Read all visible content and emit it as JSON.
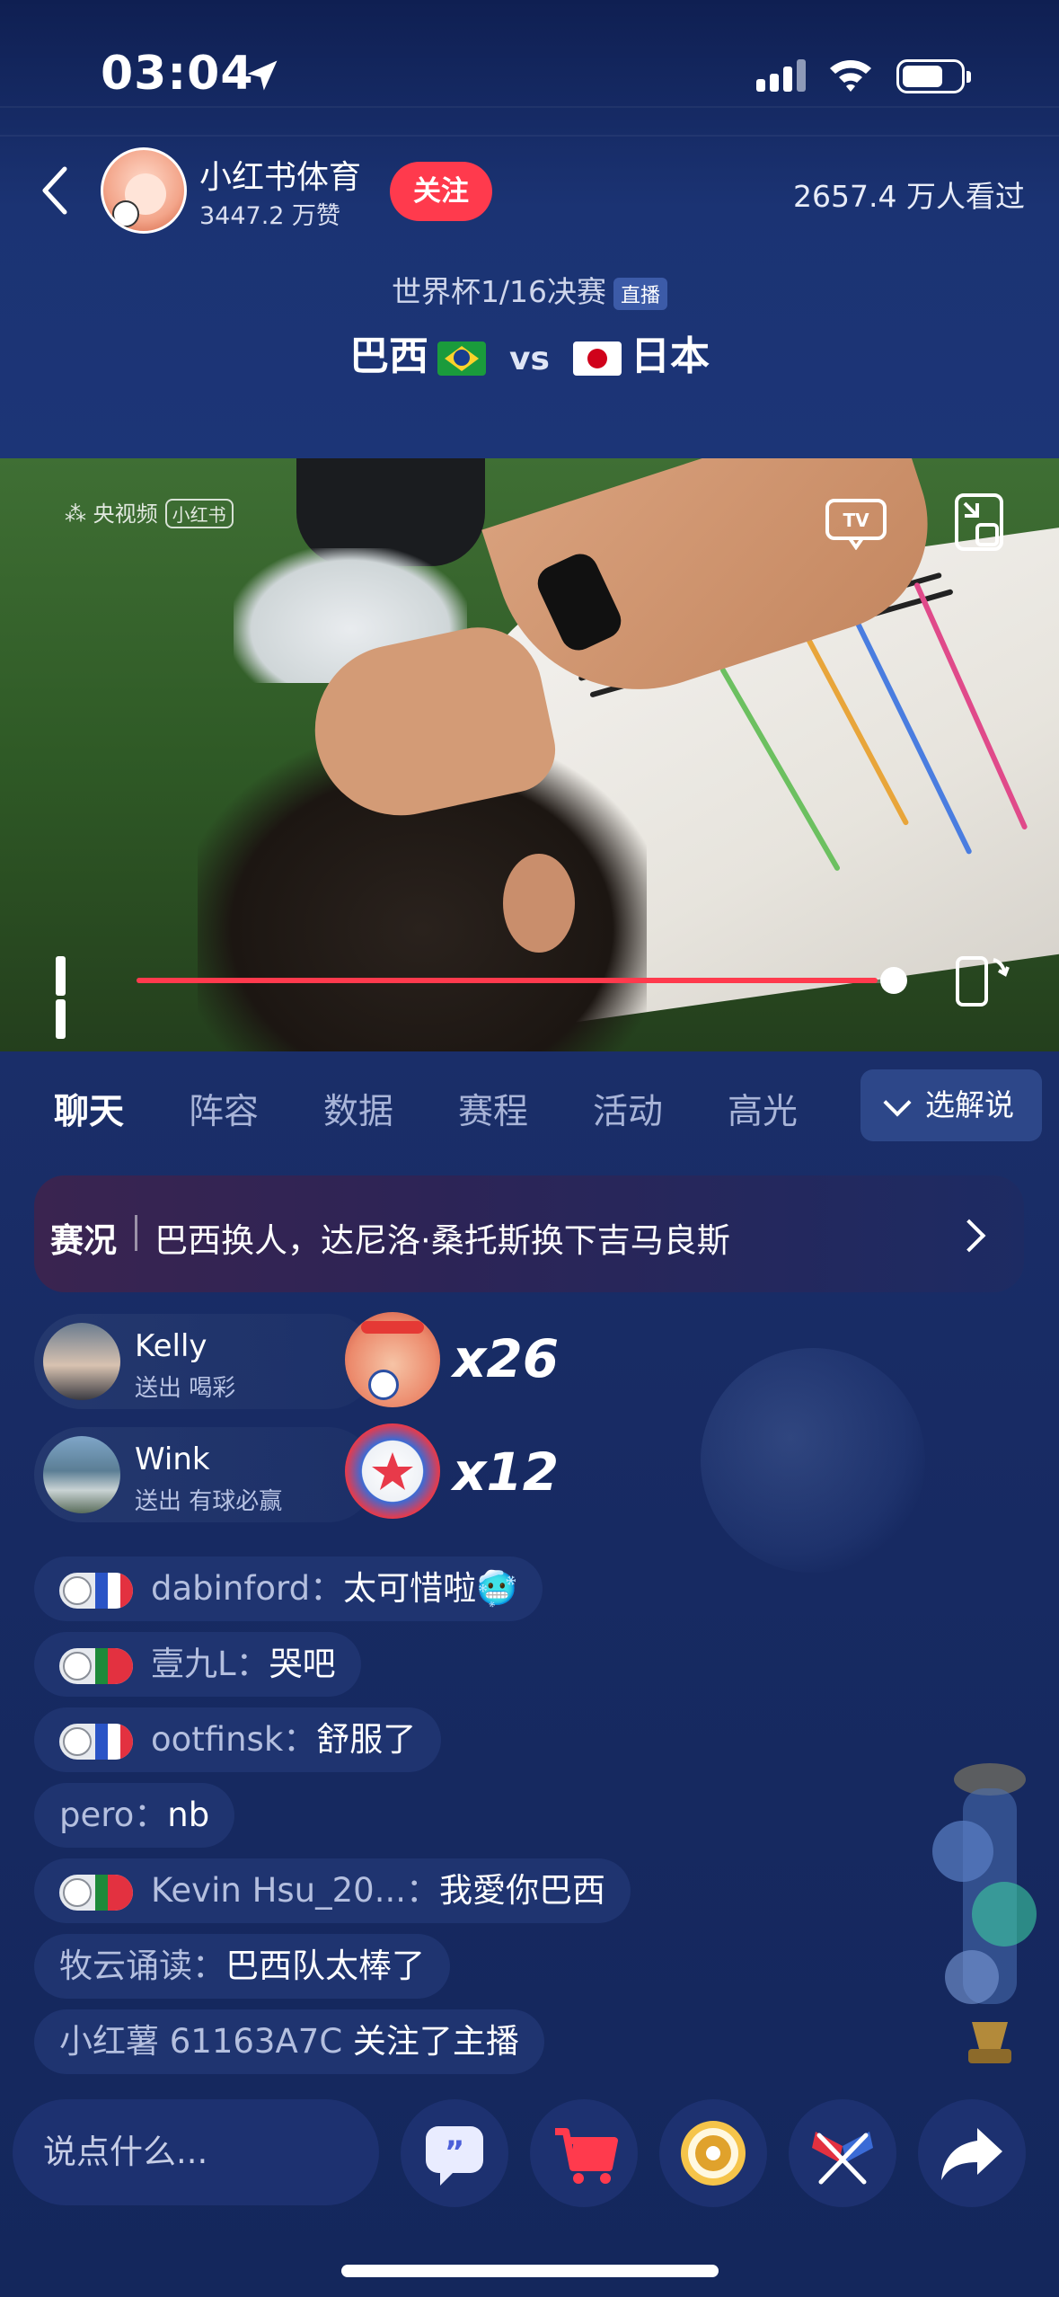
{
  "status_bar": {
    "time": "03:04"
  },
  "header": {
    "channel_name": "小红书体育",
    "likes": "3447.2 万赞",
    "follow_label": "关注",
    "viewers": "2657.4 万人看过",
    "match_round": "世界杯1/16决赛",
    "live_tag": "直播",
    "team_home": "巴西",
    "vs": "vs",
    "team_away": "日本"
  },
  "video": {
    "watermark": "央视频",
    "watermark_tag": "小红书",
    "progress_fraction": 0.97
  },
  "tabs": [
    {
      "label": "聊天",
      "active": true
    },
    {
      "label": "阵容",
      "active": false
    },
    {
      "label": "数据",
      "active": false
    },
    {
      "label": "赛程",
      "active": false
    },
    {
      "label": "活动",
      "active": false
    },
    {
      "label": "高光",
      "active": false
    }
  ],
  "commentary_button": "选解说",
  "match_update": {
    "tag": "赛况",
    "text": "巴西换人，达尼洛·桑托斯换下吉马良斯"
  },
  "gifts": [
    {
      "name": "Kelly",
      "desc": "送出 喝彩",
      "count": "x26"
    },
    {
      "name": "Wink",
      "desc": "送出 有球必赢",
      "count": "x12"
    }
  ],
  "chat": [
    {
      "user": "dabinford：",
      "message": "太可惜啦🥶",
      "badge": "france"
    },
    {
      "user": "壹九L：",
      "message": "哭吧",
      "badge": "portugal"
    },
    {
      "user": "ootfinsk：",
      "message": "舒服了",
      "badge": "france"
    },
    {
      "user": "pero：",
      "message": "nb",
      "badge": ""
    },
    {
      "user": "Kevin Hsu_20...：",
      "message": "我愛你巴西",
      "badge": "portugal"
    },
    {
      "user": "牧云诵读：",
      "message": "巴西队太棒了",
      "badge": ""
    },
    {
      "user": "小红薯 61163A7C ",
      "message": "关注了主播",
      "badge": ""
    }
  ],
  "input_placeholder": "说点什么...",
  "colors": {
    "accent_red": "#ff3a4d",
    "background": "#15285e"
  }
}
